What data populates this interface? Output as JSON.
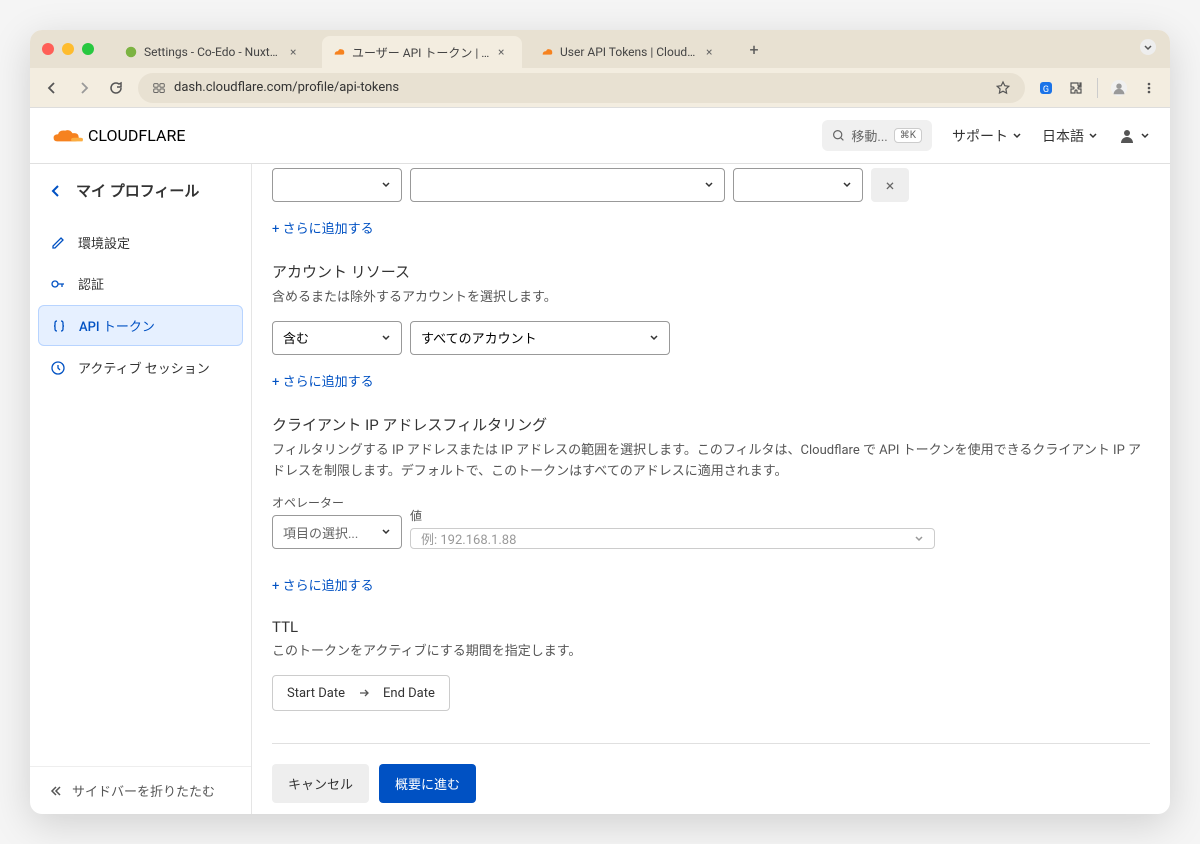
{
  "browser": {
    "tabs": [
      {
        "label": "Settings - Co-Edo - NuxtHub"
      },
      {
        "label": "ユーザー API トークン | Cloudfl"
      },
      {
        "label": "User API Tokens | Cloudflare"
      }
    ],
    "url": "dash.cloudflare.com/profile/api-tokens"
  },
  "header": {
    "logo_text": "CLOUDFLARE",
    "search_label": "移動...",
    "search_kbd": "⌘K",
    "support": "サポート",
    "language": "日本語"
  },
  "sidebar": {
    "back": "マイ プロフィール",
    "items": [
      {
        "label": "環境設定"
      },
      {
        "label": "認証"
      },
      {
        "label": "API トークン"
      },
      {
        "label": "アクティブ セッション"
      }
    ],
    "collapse": "サイドバーを折りたたむ"
  },
  "main": {
    "add_more": "+ さらに追加する",
    "account": {
      "title": "アカウント リソース",
      "desc": "含めるまたは除外するアカウントを選択します。",
      "include": "含む",
      "all": "すべてのアカウント"
    },
    "ip": {
      "title": "クライアント IP アドレスフィルタリング",
      "desc": "フィルタリングする IP アドレスまたは IP アドレスの範囲を選択します。このフィルタは、Cloudflare で API トークンを使用できるクライアント IP アドレスを制限します。デフォルトで、このトークンはすべてのアドレスに適用されます。",
      "operator_label": "オペレーター",
      "value_label": "値",
      "operator_placeholder": "項目の選択...",
      "value_placeholder": "例: 192.168.1.88"
    },
    "ttl": {
      "title": "TTL",
      "desc": "このトークンをアクティブにする期間を指定します。",
      "start": "Start Date",
      "end": "End Date"
    },
    "cancel": "キャンセル",
    "continue": "概要に進む"
  }
}
